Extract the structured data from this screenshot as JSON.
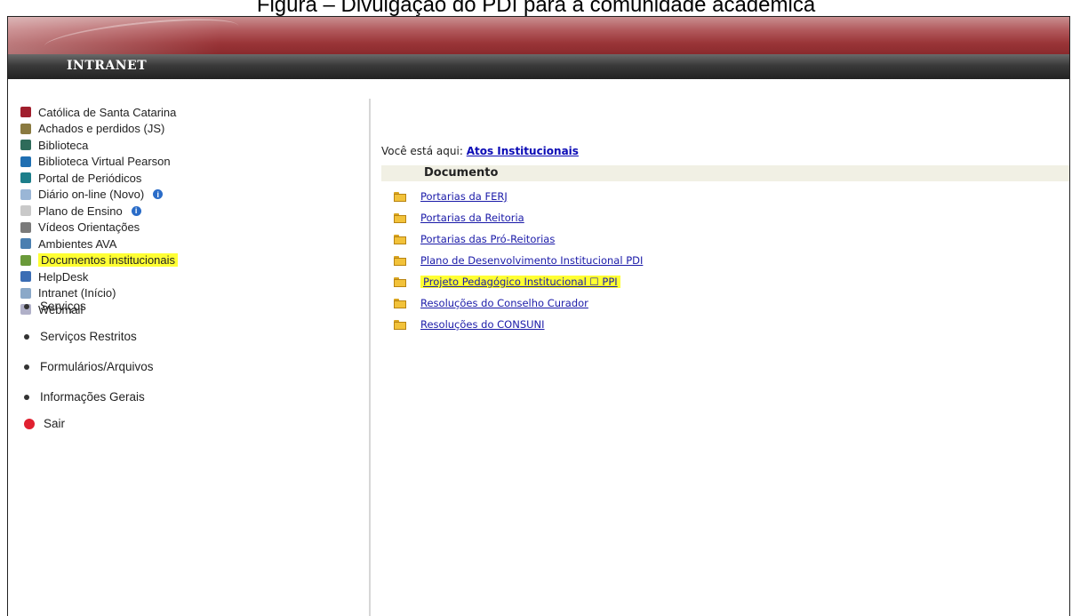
{
  "caption": "Figura – Divulgação do PDI para a comunidade acadêmica",
  "navbar": {
    "title": "INTRANET"
  },
  "sidebar": {
    "items": [
      {
        "label": "Católica de Santa Catarina",
        "icon": "shield-icon",
        "color": "#a01e2d",
        "info": false,
        "highlight": false
      },
      {
        "label": "Achados e perdidos (JS)",
        "icon": "trophy-icon",
        "color": "#8a7a40",
        "info": false,
        "highlight": false
      },
      {
        "label": "Biblioteca",
        "icon": "books-icon",
        "color": "#2e6b5a",
        "info": false,
        "highlight": false
      },
      {
        "label": "Biblioteca Virtual Pearson",
        "icon": "globe-icon",
        "color": "#1f6fb2",
        "info": false,
        "highlight": false
      },
      {
        "label": "Portal de Periódicos",
        "icon": "leaf-icon",
        "color": "#1c7e8a",
        "info": false,
        "highlight": false
      },
      {
        "label": "Diário on-line (Novo)",
        "icon": "notebook-icon",
        "color": "#9ab6d6",
        "info": true,
        "highlight": false
      },
      {
        "label": "Plano de Ensino",
        "icon": "document-icon",
        "color": "#c9c9c9",
        "info": true,
        "highlight": false
      },
      {
        "label": "Vídeos Orientações",
        "icon": "video-icon",
        "color": "#7a7a7a",
        "info": false,
        "highlight": false
      },
      {
        "label": "Ambientes AVA",
        "icon": "network-icon",
        "color": "#4a7fb0",
        "info": false,
        "highlight": false
      },
      {
        "label": "Documentos institucionais",
        "icon": "docs-icon",
        "color": "#6a9a3a",
        "info": false,
        "highlight": true
      },
      {
        "label": "HelpDesk",
        "icon": "helpdesk-icon",
        "color": "#3b6db4",
        "info": false,
        "highlight": false
      },
      {
        "label": "Intranet (Início)",
        "icon": "home-network-icon",
        "color": "#8aa8c8",
        "info": false,
        "highlight": false
      },
      {
        "label": "Webmail",
        "icon": "mail-icon",
        "color": "#b0b0c8",
        "info": false,
        "highlight": false
      }
    ],
    "sections": [
      "Serviços",
      "Serviços Restritos",
      "Formulários/Arquivos",
      "Informações Gerais"
    ],
    "logout": "Sair"
  },
  "content": {
    "breadcrumb_prefix": "Você está aqui:",
    "breadcrumb_link": "Atos Institucionais",
    "header": "Documento",
    "documents": [
      {
        "label": "Portarias da FERJ",
        "highlight": false
      },
      {
        "label": "Portarias da Reitoria",
        "highlight": false
      },
      {
        "label": "Portarias das Pró-Reitorias",
        "highlight": false
      },
      {
        "label": "Plano de Desenvolvimento Institucional PDI",
        "highlight": false
      },
      {
        "label": "Projeto Pedagógico Institucional ☐ PPI",
        "highlight": true
      },
      {
        "label": "Resoluções do Conselho Curador",
        "highlight": false
      },
      {
        "label": "Resoluções do CONSUNI",
        "highlight": false
      }
    ]
  },
  "colors": {
    "banner": "#9a3538",
    "navbar": "#333333",
    "highlight": "#ffff33",
    "link": "#1a1aa8"
  }
}
